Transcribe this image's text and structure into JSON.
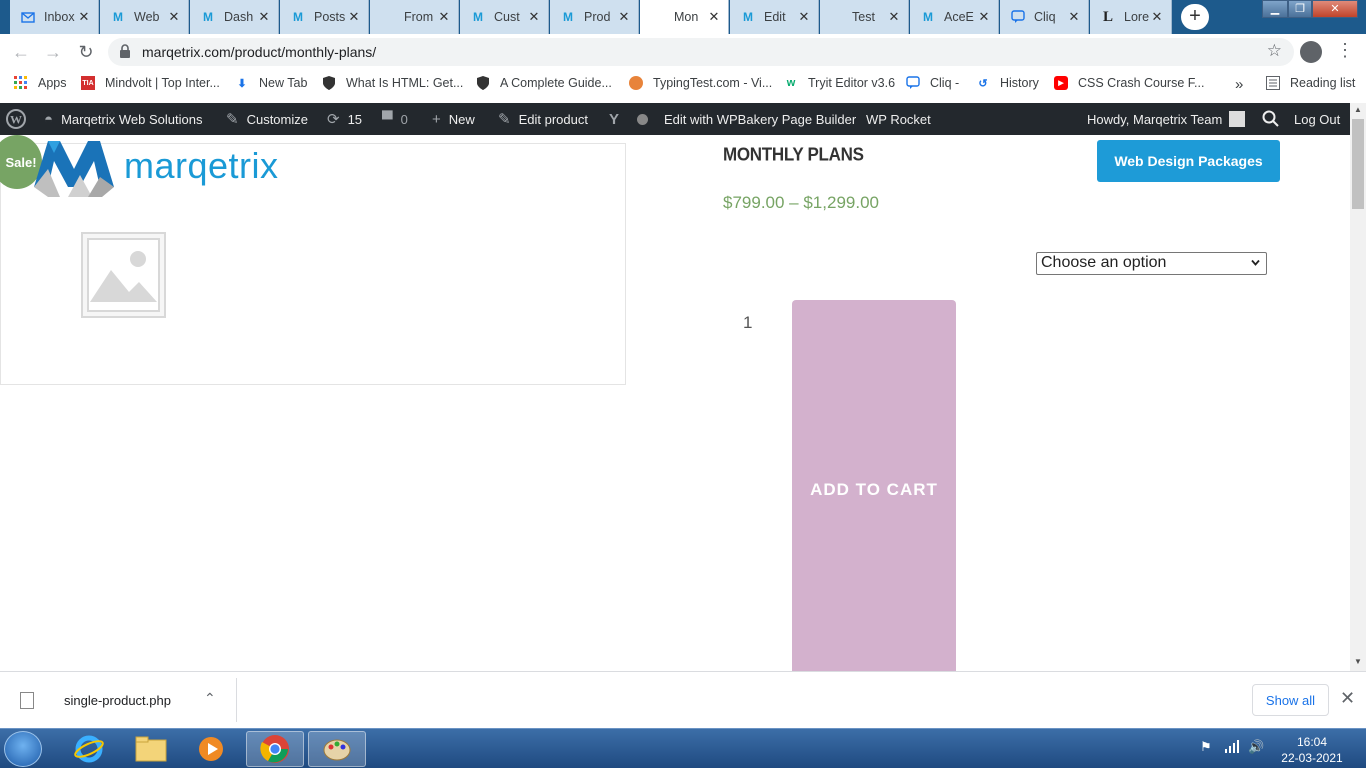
{
  "browser": {
    "tabs": [
      {
        "label": "Inbox",
        "icon": "mail-icon",
        "active": false
      },
      {
        "label": "Web",
        "icon": "marqetrix-favicon-icon",
        "active": false
      },
      {
        "label": "Dash",
        "icon": "marqetrix-favicon-icon",
        "active": false
      },
      {
        "label": "Posts",
        "icon": "marqetrix-favicon-icon",
        "active": false
      },
      {
        "label": "From",
        "icon": "blank-favicon-icon",
        "active": false
      },
      {
        "label": "Cust",
        "icon": "marqetrix-favicon-icon",
        "active": false
      },
      {
        "label": "Prod",
        "icon": "marqetrix-favicon-icon",
        "active": false
      },
      {
        "label": "Mon",
        "icon": "blank-favicon-icon",
        "active": true
      },
      {
        "label": "Edit",
        "icon": "marqetrix-favicon-icon",
        "active": false
      },
      {
        "label": "Test",
        "icon": "blank-favicon-icon",
        "active": false
      },
      {
        "label": "AceE",
        "icon": "marqetrix-favicon-icon",
        "active": false
      },
      {
        "label": "Cliq",
        "icon": "cliq-icon",
        "active": false
      },
      {
        "label": "Lore",
        "icon": "lorem-l-icon",
        "active": false
      }
    ],
    "url": "marqetrix.com/product/monthly-plans/",
    "bookmarks": [
      {
        "label": "Apps",
        "icon": "apps-grid-icon"
      },
      {
        "label": "Mindvolt | Top Inter...",
        "icon": "tia-icon"
      },
      {
        "label": "New Tab",
        "icon": "download-arrow-icon"
      },
      {
        "label": "What Is HTML: Get...",
        "icon": "shield-icon"
      },
      {
        "label": "A Complete Guide...",
        "icon": "shield-icon"
      },
      {
        "label": "TypingTest.com - Vi...",
        "icon": "typingtest-icon"
      },
      {
        "label": "Tryit Editor v3.6",
        "icon": "w3-icon"
      },
      {
        "label": "Cliq -",
        "icon": "cliq-icon"
      },
      {
        "label": "History",
        "icon": "history-icon"
      },
      {
        "label": "CSS Crash Course F...",
        "icon": "youtube-icon"
      }
    ],
    "overflow": "»",
    "reading_list": "Reading list"
  },
  "wpbar": {
    "site": "Marqetrix Web Solutions",
    "customize": "Customize",
    "updates": "15",
    "comments": "0",
    "new": "New",
    "edit_product": "Edit product",
    "wpbakery": "Edit with WPBakery Page Builder",
    "rocket": "WP Rocket",
    "howdy": "Howdy, Marqetrix Team",
    "logout": "Log Out"
  },
  "product": {
    "sale_badge": "Sale!",
    "logo_text": "marqetrix",
    "title": "MONTHLY PLANS",
    "category_button": "Web Design Packages",
    "price": "$799.00 – $1,299.00",
    "variation_placeholder": "Choose an option",
    "quantity": "1",
    "add_to_cart": "ADD TO CART"
  },
  "download": {
    "file": "single-product.php",
    "show_all": "Show all"
  },
  "taskbar": {
    "time": "16:04",
    "date": "22-03-2021"
  },
  "colors": {
    "accent_blue": "#1e9bd7",
    "price_green": "#77a464",
    "add_to_cart": "#d3b1cd",
    "wp_bar": "#23282d"
  }
}
